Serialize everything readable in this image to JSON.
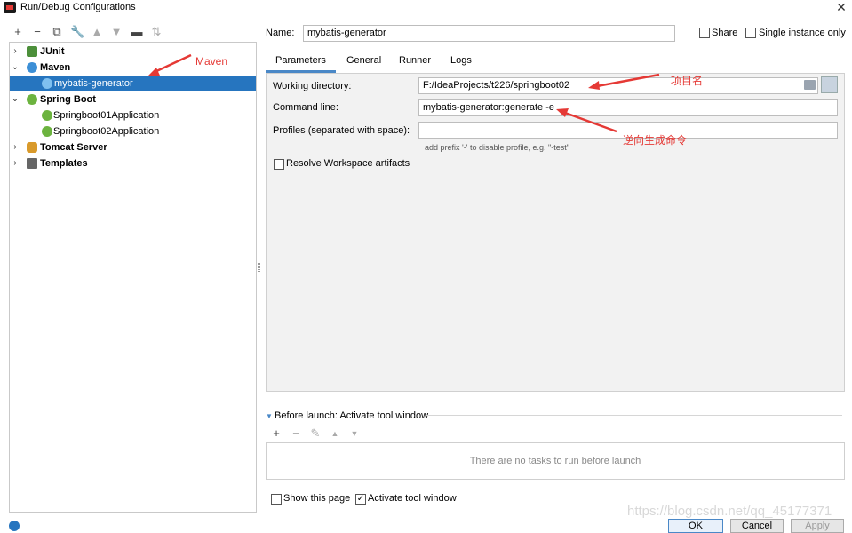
{
  "window": {
    "title": "Run/Debug Configurations"
  },
  "left_toolbar": {
    "icons": [
      "add-icon",
      "remove-icon",
      "copy-icon",
      "wrench-icon",
      "move-up-icon",
      "move-down-icon",
      "folder-icon",
      "sort-icon"
    ]
  },
  "tree": {
    "items": [
      {
        "label": "JUnit"
      },
      {
        "label": "Maven"
      },
      {
        "label": "mybatis-generator"
      },
      {
        "label": "Spring Boot"
      },
      {
        "label": "Springboot01Application"
      },
      {
        "label": "Springboot02Application"
      },
      {
        "label": "Tomcat Server"
      },
      {
        "label": "Templates"
      }
    ]
  },
  "header": {
    "name_label": "Name:",
    "name_value": "mybatis-generator",
    "share_label": "Share",
    "single_instance_label": "Single instance only"
  },
  "tabs": [
    {
      "label": "Parameters"
    },
    {
      "label": "General"
    },
    {
      "label": "Runner"
    },
    {
      "label": "Logs"
    }
  ],
  "params": {
    "working_dir_label": "Working directory:",
    "working_dir_value": "F:/IdeaProjects/t226/springboot02",
    "command_line_label": "Command line:",
    "command_line_value": "mybatis-generator:generate -e",
    "profiles_label": "Profiles (separated with space):",
    "profiles_value": "",
    "profiles_hint": "add prefix '-' to disable profile, e.g. \"-test\"",
    "resolve_label": "Resolve Workspace artifacts"
  },
  "before_launch": {
    "title": "Before launch: Activate tool window",
    "empty_message": "There are no tasks to run before launch",
    "show_page_label": "Show this page",
    "activate_label": "Activate tool window"
  },
  "annotations": {
    "maven": "Maven",
    "project_name": "项目名",
    "reverse_command": "逆向生成命令"
  },
  "footer": {
    "ok": "OK",
    "cancel": "Cancel",
    "apply": "Apply",
    "watermark": "https://blog.csdn.net/qq_45177371"
  },
  "colors": {
    "selection": "#2675bf",
    "annotation": "#e53935",
    "tab_underline": "#4a88c7"
  }
}
